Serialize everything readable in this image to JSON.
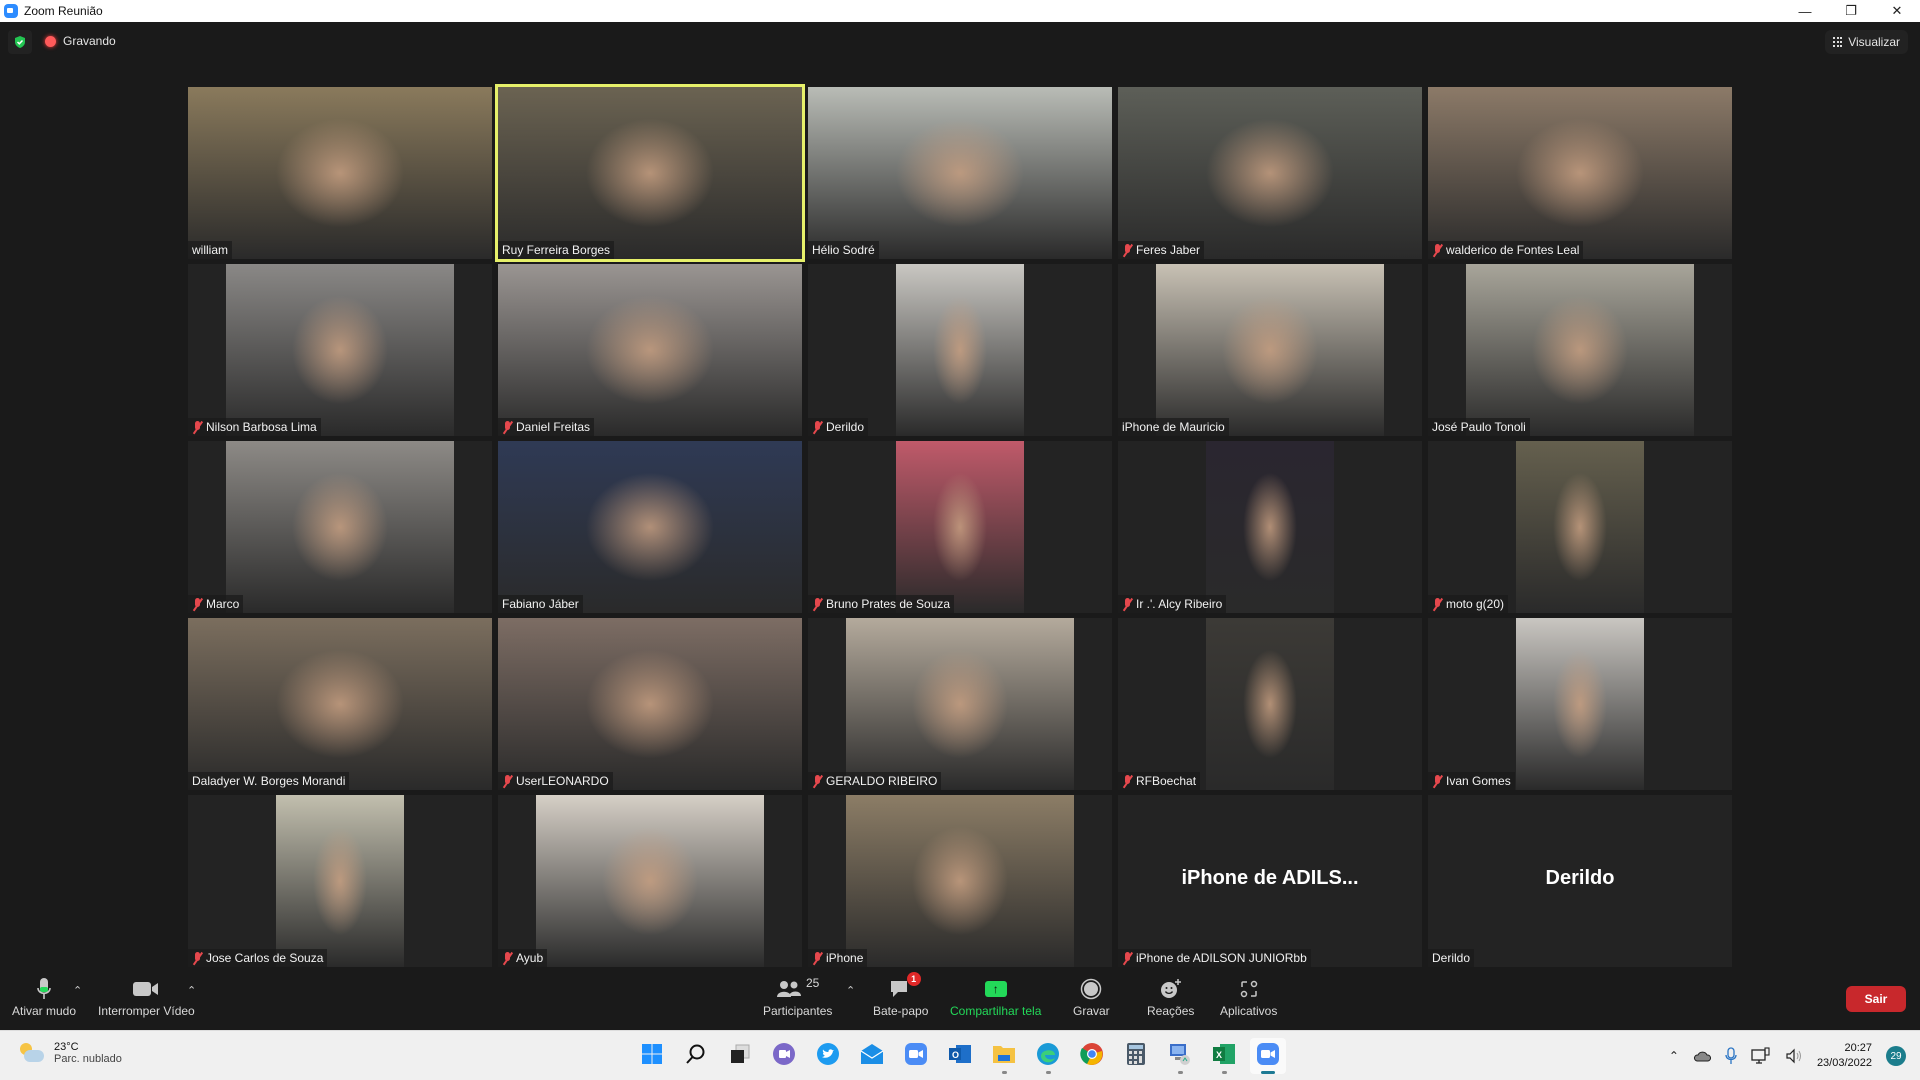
{
  "window": {
    "title": "Zoom Reunião",
    "controls": [
      "minimize",
      "restore",
      "close"
    ]
  },
  "topbar": {
    "security_icon": "shield-check-icon",
    "recording_label": "Gravando",
    "view_label": "Visualizar"
  },
  "colors": {
    "active_speaker_border": "#e6f06a",
    "share_green": "#23d959",
    "leave_red": "#c8282c",
    "muted_red": "#e5484d",
    "background": "#1a1a1a"
  },
  "participants": [
    {
      "name": "william",
      "muted": false,
      "active": false,
      "video": true,
      "bg": "#8a7a5c",
      "narrow": false
    },
    {
      "name": "Ruy Ferreira Borges",
      "muted": false,
      "active": true,
      "video": true,
      "bg": "#6b6352",
      "narrow": false
    },
    {
      "name": "Hélio Sodré",
      "muted": false,
      "active": false,
      "video": true,
      "bg": "#b9bcb6",
      "narrow": false
    },
    {
      "name": "Feres Jaber",
      "muted": true,
      "active": false,
      "video": true,
      "bg": "#5d5f58",
      "narrow": false
    },
    {
      "name": "walderico de Fontes Leal",
      "muted": true,
      "active": false,
      "video": true,
      "bg": "#8c7a68",
      "narrow": false
    },
    {
      "name": "Nilson Barbosa Lima",
      "muted": true,
      "active": false,
      "video": true,
      "bg": "#8a8886",
      "narrow": true
    },
    {
      "name": "Daniel Freitas",
      "muted": true,
      "active": false,
      "video": true,
      "bg": "#9a9592",
      "narrow": false
    },
    {
      "name": "Derildo",
      "muted": true,
      "active": false,
      "video": true,
      "bg": "#c9c7c2",
      "narrow": "xs"
    },
    {
      "name": "iPhone de Mauricio",
      "muted": false,
      "active": false,
      "video": true,
      "bg": "#c8c1b4",
      "narrow": true
    },
    {
      "name": "José Paulo Tonoli",
      "muted": false,
      "active": false,
      "video": true,
      "bg": "#a8a59a",
      "narrow": true
    },
    {
      "name": "Marco",
      "muted": true,
      "active": false,
      "video": true,
      "bg": "#8d8a86",
      "narrow": true
    },
    {
      "name": "Fabiano Jáber",
      "muted": false,
      "active": false,
      "video": true,
      "bg": "#2f3a55",
      "narrow": false
    },
    {
      "name": "Bruno Prates de Souza",
      "muted": true,
      "active": false,
      "video": true,
      "bg": "#c05a6a",
      "narrow": "xs"
    },
    {
      "name": "Ir .'. Alcy Ribeiro",
      "muted": true,
      "active": false,
      "video": true,
      "bg": "#2a2630",
      "narrow": "xs"
    },
    {
      "name": "moto g(20)",
      "muted": true,
      "active": false,
      "video": true,
      "bg": "#65604e",
      "narrow": "xs"
    },
    {
      "name": "Daladyer W. Borges Morandi",
      "muted": false,
      "active": false,
      "video": true,
      "bg": "#7b6e5e",
      "narrow": false
    },
    {
      "name": "UserLEONARDO",
      "muted": true,
      "active": false,
      "video": true,
      "bg": "#7d6d64",
      "narrow": false
    },
    {
      "name": "GERALDO RIBEIRO",
      "muted": true,
      "active": false,
      "video": true,
      "bg": "#b4aa9c",
      "narrow": true
    },
    {
      "name": "RFBoechat",
      "muted": true,
      "active": false,
      "video": true,
      "bg": "#3c3a36",
      "narrow": "xs"
    },
    {
      "name": "Ivan Gomes",
      "muted": true,
      "active": false,
      "video": true,
      "bg": "#c9c6c1",
      "narrow": "xs"
    },
    {
      "name": "Jose Carlos de Souza",
      "muted": true,
      "active": false,
      "video": true,
      "bg": "#c2bfae",
      "narrow": "xs"
    },
    {
      "name": "Ayub",
      "muted": true,
      "active": false,
      "video": true,
      "bg": "#d6cfc6",
      "narrow": true
    },
    {
      "name": "iPhone",
      "muted": true,
      "active": false,
      "video": true,
      "bg": "#8c7d66",
      "narrow": true
    },
    {
      "name": "iPhone de ADILSON JUNIORbb",
      "muted": true,
      "active": false,
      "video": false,
      "display": "iPhone de ADILS..."
    },
    {
      "name": "Derildo",
      "muted": false,
      "active": false,
      "video": false,
      "display": "Derildo"
    }
  ],
  "toolbar": {
    "mute": {
      "label": "Ativar mudo",
      "icon": "microphone-icon"
    },
    "video": {
      "label": "Interromper Vídeo",
      "icon": "video-camera-icon"
    },
    "participants": {
      "label": "Participantes",
      "count": "25",
      "icon": "participants-icon"
    },
    "chat": {
      "label": "Bate-papo",
      "badge": "1",
      "icon": "chat-icon"
    },
    "share": {
      "label": "Compartilhar tela",
      "icon": "share-screen-icon"
    },
    "record": {
      "label": "Gravar",
      "icon": "record-icon"
    },
    "reactions": {
      "label": "Reações",
      "icon": "reaction-icon"
    },
    "apps": {
      "label": "Aplicativos",
      "icon": "apps-icon"
    },
    "leave": {
      "label": "Sair"
    }
  },
  "taskbar": {
    "weather": {
      "temp": "23°C",
      "desc": "Parc. nublado"
    },
    "apps": [
      {
        "name": "start",
        "active": false,
        "running": false
      },
      {
        "name": "search",
        "active": false,
        "running": false
      },
      {
        "name": "task-view",
        "active": false,
        "running": false
      },
      {
        "name": "teams-chat",
        "active": false,
        "running": false
      },
      {
        "name": "twitter",
        "active": false,
        "running": false
      },
      {
        "name": "mail",
        "active": false,
        "running": false
      },
      {
        "name": "zoom-pinned",
        "active": false,
        "running": false
      },
      {
        "name": "outlook",
        "active": false,
        "running": false
      },
      {
        "name": "file-explorer",
        "active": false,
        "running": true
      },
      {
        "name": "edge",
        "active": false,
        "running": true
      },
      {
        "name": "chrome",
        "active": false,
        "running": false
      },
      {
        "name": "calculator",
        "active": false,
        "running": false
      },
      {
        "name": "remote-desktop",
        "active": false,
        "running": true
      },
      {
        "name": "excel",
        "active": false,
        "running": true
      },
      {
        "name": "zoom",
        "active": true,
        "running": true
      }
    ],
    "time": "20:27",
    "date": "23/03/2022",
    "notifications": "29"
  }
}
